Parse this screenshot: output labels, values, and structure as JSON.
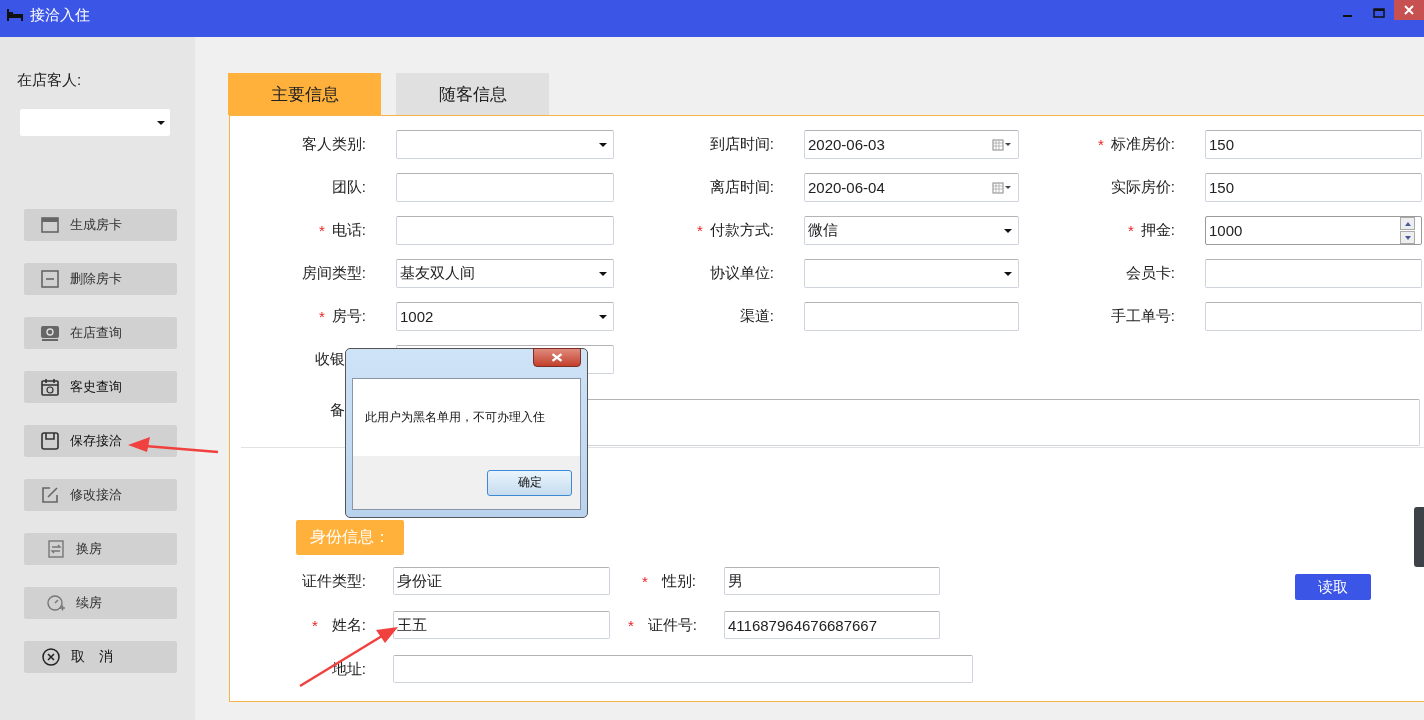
{
  "window": {
    "title": "接洽入住"
  },
  "sidebar": {
    "guest_label": "在店客人:",
    "buttons": [
      {
        "label": "生成房卡",
        "kind": "card"
      },
      {
        "label": "删除房卡",
        "kind": "minus"
      },
      {
        "label": "在店查询",
        "kind": "money"
      },
      {
        "label": "客史查询",
        "kind": "calendar"
      },
      {
        "label": "保存接洽",
        "kind": "save"
      },
      {
        "label": "修改接洽",
        "kind": "edit"
      },
      {
        "label": "换房",
        "kind": "swap"
      },
      {
        "label": "续房",
        "kind": "clock"
      },
      {
        "label": "取　消",
        "kind": "cancel"
      }
    ]
  },
  "tabs": [
    {
      "label": "主要信息",
      "selected": true
    },
    {
      "label": "随客信息",
      "selected": false
    }
  ],
  "main_form": {
    "rows": [
      [
        {
          "label": "客人类别:",
          "kind": "select"
        },
        {
          "label": "到店时间:",
          "kind": "date",
          "value": "2020-06-03"
        },
        {
          "required_mark": "*",
          "label": "标准房价:",
          "kind": "text",
          "value": "150"
        }
      ],
      [
        {
          "label": "团队:",
          "kind": "text"
        },
        {
          "label": "离店时间:",
          "kind": "date",
          "value": "2020-06-04"
        },
        {
          "label": "实际房价:",
          "kind": "text",
          "value": "150"
        }
      ],
      [
        {
          "required_mark": "*",
          "label": "电话:",
          "kind": "text"
        },
        {
          "required_mark": "*",
          "label": "付款方式:",
          "kind": "select",
          "value": "微信"
        },
        {
          "required_mark": "*",
          "label": "押金:",
          "kind": "spin",
          "value": "1000"
        }
      ],
      [
        {
          "label": "房间类型:",
          "kind": "select",
          "value": "基友双人间"
        },
        {
          "label": "协议单位:",
          "kind": "select"
        },
        {
          "label": "会员卡:",
          "kind": "text"
        }
      ],
      [
        {
          "required_mark": "*",
          "label": "房号:",
          "kind": "select",
          "value": "1002"
        },
        {
          "label": "渠道:",
          "kind": "text"
        },
        {
          "label": "手工单号:",
          "kind": "text"
        }
      ],
      [
        {
          "label": "收银",
          "kind": "text",
          "covered": true
        }
      ],
      [
        {
          "label": "备",
          "kind": "textarea",
          "covered": true
        }
      ]
    ]
  },
  "identity": {
    "title": "身份信息：",
    "rows": [
      [
        {
          "label": "证件类型:",
          "value": "身份证"
        },
        {
          "required_mark": "*",
          "label": "性别:",
          "value": "男"
        }
      ],
      [
        {
          "required_mark": "*",
          "label": "姓名:",
          "value": "王五"
        },
        {
          "required_mark": "*",
          "label": "证件号:",
          "value": "411687964676687667"
        }
      ],
      [
        {
          "label": "地址:",
          "wide": true
        }
      ]
    ],
    "read_button": "读取"
  },
  "dialog": {
    "message": "此用户为黑名单用，不可办理入住",
    "ok_button": "确定"
  }
}
